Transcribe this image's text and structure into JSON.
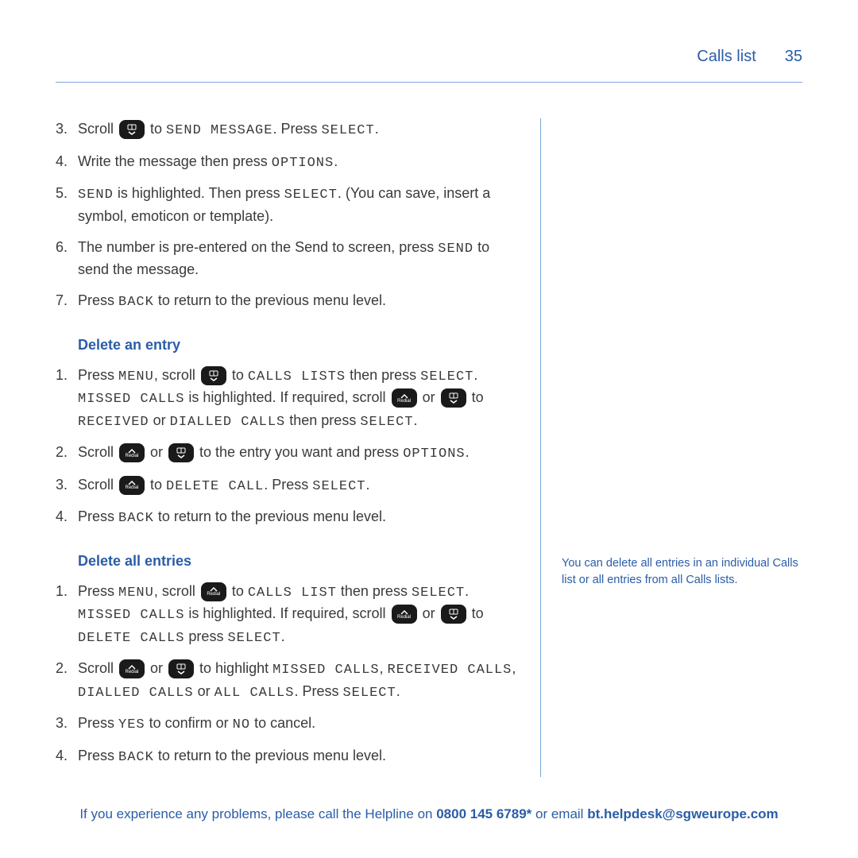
{
  "header": {
    "title": "Calls list",
    "page": "35"
  },
  "section1": {
    "items": [
      {
        "pre": "Scroll ",
        "post": " to ",
        "ui1": "SEND MESSAGE",
        "mid": ". Press ",
        "ui2": "SELECT",
        "end": "."
      },
      {
        "t1": "Write the message then press ",
        "u1": "OPTIONS",
        "t2": "."
      },
      {
        "u1": "SEND",
        "t1": " is highlighted. Then press ",
        "u2": "SELECT",
        "t2": ". (You can save, insert a symbol, emoticon or template)."
      },
      {
        "t1": "The number is pre-entered on the Send to screen, press ",
        "u1": "SEND",
        "t2": " to send the message."
      },
      {
        "t1": "Press ",
        "u1": "BACK",
        "t2": " to return to the previous menu level."
      }
    ]
  },
  "section2": {
    "heading": "Delete an entry",
    "items": [
      {
        "t1": "Press ",
        "u1": "MENU",
        "t2": ", scroll ",
        "t3": " to ",
        "u2": "CALLS LISTS",
        "t4": " then press ",
        "u3": "SELECT",
        "t5": ". ",
        "u4": "MISSED CALLS",
        "t6": " is highlighted. If required, scroll ",
        "t7": " or ",
        "t8": " to ",
        "u5": "RECEIVED",
        "t9": " or ",
        "u6": "DIALLED CALLS",
        "t10": " then press ",
        "u7": "SELECT",
        "t11": "."
      },
      {
        "t1": "Scroll ",
        "t2": " or ",
        "t3": " to the entry you want and press ",
        "u1": "OPTIONS",
        "t4": "."
      },
      {
        "t1": "Scroll ",
        "t2": " to ",
        "u1": "DELETE CALL",
        "t3": ". Press ",
        "u2": "SELECT",
        "t4": "."
      },
      {
        "t1": "Press ",
        "u1": "BACK",
        "t2": " to return to the previous menu level."
      }
    ]
  },
  "section3": {
    "heading": "Delete all entries",
    "items": [
      {
        "t1": "Press ",
        "u1": "MENU",
        "t2": ", scroll ",
        "t3": " to ",
        "u2": "CALLS LIST",
        "t4": " then press ",
        "u3": "SELECT",
        "t5": ". ",
        "u4": "MISSED CALLS",
        "t6": " is highlighted. If required, scroll ",
        "t7": " or ",
        "t8": " to ",
        "u5": "DELETE CALLS",
        "t9": " press ",
        "u6": "SELECT",
        "t10": "."
      },
      {
        "t1": "Scroll ",
        "t2": " or ",
        "t3": " to highlight ",
        "u1": "MISSED CALLS",
        "t4": ", ",
        "u2": "RECEIVED CALLS",
        "t5": ", ",
        "u3": "DIALLED CALLS",
        "t6": " or ",
        "u4": "ALL CALLS",
        "t7": ". Press ",
        "u5": "SELECT",
        "t8": "."
      },
      {
        "t1": "Press ",
        "u1": "YES",
        "t2": " to confirm or ",
        "u2": "NO",
        "t3": " to cancel."
      },
      {
        "t1": "Press ",
        "u1": "BACK",
        "t2": " to return to the previous menu level."
      }
    ]
  },
  "sidebar": {
    "note": "You can delete all entries in an individual Calls list or all entries from all Calls lists."
  },
  "footer": {
    "t1": "If you experience any problems, please call the Helpline on ",
    "phone": "0800 145 6789*",
    "t2": " or email ",
    "email": "bt.helpdesk@sgweurope.com"
  }
}
